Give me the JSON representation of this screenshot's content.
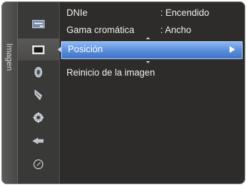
{
  "side_tab": {
    "label": "Imagen"
  },
  "icons": [
    {
      "name": "input-icon",
      "active": false
    },
    {
      "name": "picture-icon",
      "active": true
    },
    {
      "name": "sound-icon",
      "active": false
    },
    {
      "name": "channel-icon",
      "active": false
    },
    {
      "name": "setup-icon",
      "active": false
    },
    {
      "name": "input-source-icon",
      "active": false
    },
    {
      "name": "clock-icon",
      "active": false
    }
  ],
  "menu": {
    "items": [
      {
        "label": "DNIe",
        "value": ": Encendido"
      },
      {
        "label": "Gama cromática",
        "value": ": Ancho"
      },
      {
        "label": "Posición",
        "value": ""
      },
      {
        "label": "Reinicio de la imagen",
        "value": ""
      }
    ],
    "selected_index": 2
  },
  "colors": {
    "panel": "#2d2c2a",
    "selection": "#5f92df"
  }
}
